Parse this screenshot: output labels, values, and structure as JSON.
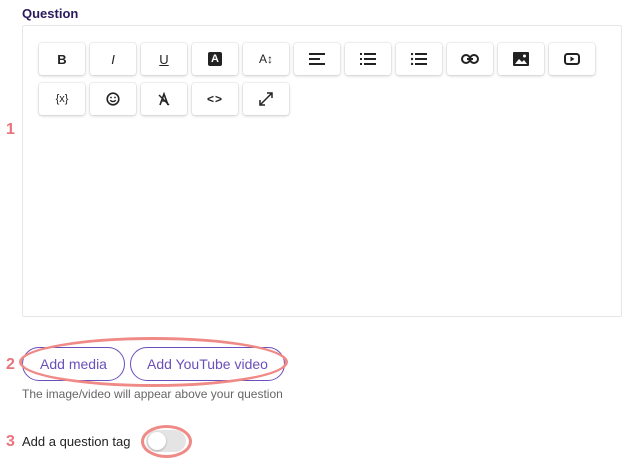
{
  "question": {
    "label": "Question"
  },
  "toolbar": {
    "buttons": [
      {
        "name": "bold-button",
        "icon": "bold-icon",
        "text": "B"
      },
      {
        "name": "italic-button",
        "icon": "italic-icon",
        "text": "I"
      },
      {
        "name": "underline-button",
        "icon": "underline-icon",
        "text": "U"
      },
      {
        "name": "text-color-button",
        "icon": "text-color-icon",
        "text": "A"
      },
      {
        "name": "font-size-button",
        "icon": "font-size-icon",
        "text": "A↕"
      },
      {
        "name": "align-button",
        "icon": "align-left-icon",
        "text": ""
      },
      {
        "name": "numbered-list-button",
        "icon": "numbered-list-icon",
        "text": ""
      },
      {
        "name": "bullet-list-button",
        "icon": "bullet-list-icon",
        "text": ""
      },
      {
        "name": "link-button",
        "icon": "link-icon",
        "text": ""
      },
      {
        "name": "image-button",
        "icon": "image-icon",
        "text": ""
      },
      {
        "name": "video-button",
        "icon": "video-icon",
        "text": ""
      },
      {
        "name": "formula-button",
        "icon": "formula-icon",
        "text": "{x}"
      },
      {
        "name": "emoji-button",
        "icon": "emoji-icon",
        "text": ""
      },
      {
        "name": "clear-format-button",
        "icon": "clear-format-icon",
        "text": ""
      },
      {
        "name": "code-button",
        "icon": "code-icon",
        "text": "<>"
      },
      {
        "name": "fullscreen-button",
        "icon": "fullscreen-icon",
        "text": ""
      }
    ]
  },
  "annotations": {
    "one": "1",
    "two": "2",
    "three": "3"
  },
  "media": {
    "add_media_label": "Add media",
    "add_youtube_label": "Add YouTube video",
    "helper_text": "The image/video will appear above your question"
  },
  "tag": {
    "label": "Add a question tag",
    "enabled": false
  },
  "colors": {
    "accent": "#6b4fbb",
    "annotation": "#e8747c",
    "title": "#2b1a5c"
  }
}
